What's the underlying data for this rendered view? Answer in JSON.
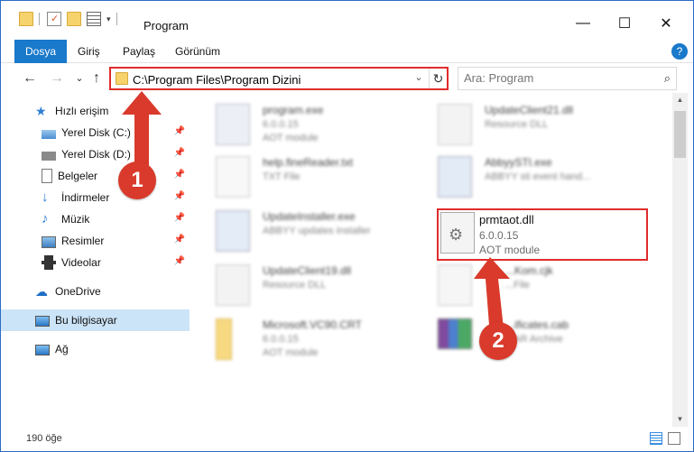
{
  "window": {
    "title": "Program"
  },
  "ribbon": {
    "tabs": [
      "Dosya",
      "Giriş",
      "Paylaş",
      "Görünüm"
    ],
    "active_tab": "Dosya",
    "help_glyph": "?"
  },
  "nav": {
    "back_glyph": "←",
    "forward_glyph": "→",
    "recent_glyph": "⌄",
    "up_glyph": "↑",
    "address_path": "C:\\Program Files\\Program Dizini",
    "search_placeholder": "Ara: Program"
  },
  "sidebar": {
    "items": [
      {
        "label": "Hızlı erişim",
        "icon": "star-icon",
        "pinned": false
      },
      {
        "label": "Yerel Disk (C:)",
        "icon": "drive-icon",
        "pinned": true
      },
      {
        "label": "Yerel Disk (D:)",
        "icon": "drive-icon",
        "pinned": true
      },
      {
        "label": "Belgeler",
        "icon": "documents-icon",
        "pinned": true
      },
      {
        "label": "İndirmeler",
        "icon": "downloads-icon",
        "pinned": true
      },
      {
        "label": "Müzik",
        "icon": "music-icon",
        "pinned": true
      },
      {
        "label": "Resimler",
        "icon": "pictures-icon",
        "pinned": true
      },
      {
        "label": "Videolar",
        "icon": "videos-icon",
        "pinned": true
      },
      {
        "label": "OneDrive",
        "icon": "cloud-icon",
        "pinned": false
      },
      {
        "label": "Bu bilgisayar",
        "icon": "computer-icon",
        "pinned": false,
        "selected": true
      },
      {
        "label": "Ağ",
        "icon": "network-icon",
        "pinned": false
      }
    ]
  },
  "files": [
    {
      "name": "program.exe",
      "meta1": "6.0.0.15",
      "meta2": "AOT module",
      "icon": "exe-icon"
    },
    {
      "name": "UpdateClient21.dll",
      "meta1": "Resource DLL",
      "meta2": "",
      "icon": "dll-icon"
    },
    {
      "name": "help.fineReader.txt",
      "meta1": "TXT File",
      "meta2": "",
      "icon": "txt-icon"
    },
    {
      "name": "AbbyySTI.exe",
      "meta1": "ABBYY sti event hand...",
      "meta2": "",
      "icon": "exe-icon"
    },
    {
      "name": "UpdateInstaller.exe",
      "meta1": "ABBYY updates installer",
      "meta2": "",
      "icon": "exe-icon"
    },
    {
      "name": "prmtaot.dll",
      "meta1": "6.0.0.15",
      "meta2": "AOT module",
      "icon": "dll-gear-icon",
      "highlighted": true
    },
    {
      "name": "UpdateClient19.dll",
      "meta1": "Resource DLL",
      "meta2": "",
      "icon": "dll-icon"
    },
    {
      "name": "...Kom.cjk",
      "meta1": "...File",
      "meta2": "",
      "icon": "file-icon"
    },
    {
      "name": "Microsoft.VC90.CRT",
      "meta1": "6.0.0.15",
      "meta2": "AOT module",
      "icon": "folder-icon"
    },
    {
      "name": "...ificates.cab",
      "meta1": "...AR Archive",
      "meta2": "",
      "icon": "archive-icon"
    }
  ],
  "status": {
    "item_count": "190 öğe"
  },
  "annotations": {
    "badge1": "1",
    "badge2": "2"
  },
  "colors": {
    "accent": "#1979ca",
    "highlight": "#e02c2c",
    "badge": "#d93a2b",
    "selected": "#cce4f7"
  }
}
